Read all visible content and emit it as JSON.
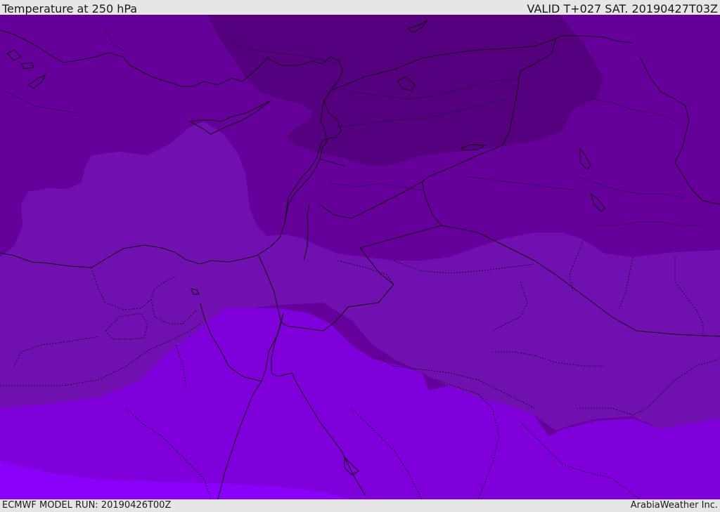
{
  "header": {
    "title": "Temperature at 250 hPa",
    "valid_time": "VALID T+027 SAT. 20190427T03Z"
  },
  "footer": {
    "model_run": "ECMWF MODEL RUN: 20190426T00Z",
    "credit": "ArabiaWeather Inc."
  },
  "map": {
    "variable": "temperature",
    "pressure_level_hpa": 250,
    "colors": {
      "darkest_band": "#55007f",
      "dark_band": "#66009a",
      "mid_band": "#7110b0",
      "light_band": "#8000db",
      "lightest_band": "#8a00f8",
      "boundaries": "#111111"
    }
  }
}
